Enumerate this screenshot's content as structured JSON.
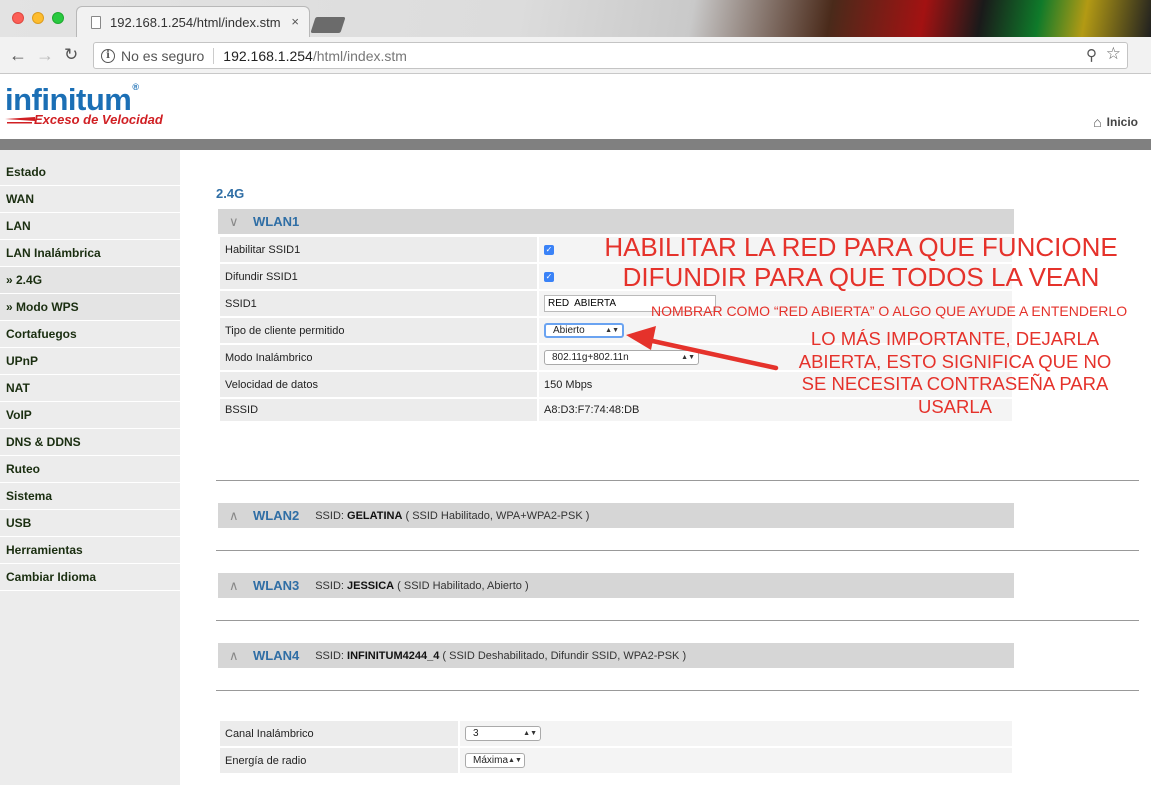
{
  "browser": {
    "tab_title": "192.168.1.254/html/index.stm",
    "tab_close": "×",
    "security_label": "No es seguro",
    "url_host": "192.168.1.254",
    "url_path": "/html/index.stm"
  },
  "header": {
    "logo_text": "infinitum",
    "logo_tm": "®",
    "logo_tagline": "Exceso de Velocidad",
    "home_label": "Inicio"
  },
  "sidebar": {
    "items": [
      {
        "label": "Estado"
      },
      {
        "label": "WAN"
      },
      {
        "label": "LAN"
      },
      {
        "label": "LAN Inalámbrica"
      },
      {
        "label": "» 2.4G"
      },
      {
        "label": "» Modo WPS"
      },
      {
        "label": "Cortafuegos"
      },
      {
        "label": "UPnP"
      },
      {
        "label": "NAT"
      },
      {
        "label": "VoIP"
      },
      {
        "label": "DNS & DDNS"
      },
      {
        "label": "Ruteo"
      },
      {
        "label": "Sistema"
      },
      {
        "label": "USB"
      },
      {
        "label": "Herramientas"
      },
      {
        "label": "Cambiar Idioma"
      }
    ]
  },
  "main": {
    "section_title": "2.4G",
    "wlan1": {
      "name": "WLAN1",
      "rows": {
        "enable_label": "Habilitar SSID1",
        "broadcast_label": "Difundir SSID1",
        "ssid_label": "SSID1",
        "ssid_value": "RED  ABIERTA",
        "client_type_label": "Tipo de cliente permitido",
        "client_type_value": "Abierto",
        "mode_label": "Modo Inalámbrico",
        "mode_value": "802.11g+802.11n",
        "rate_label": "Velocidad de datos",
        "rate_value": "150 Mbps",
        "bssid_label": "BSSID",
        "bssid_value": "A8:D3:F7:74:48:DB"
      }
    },
    "wlan2": {
      "name": "WLAN2",
      "ssid_prefix": "SSID:",
      "ssid": "GELATINA",
      "details": "( SSID Habilitado, WPA+WPA2-PSK )"
    },
    "wlan3": {
      "name": "WLAN3",
      "ssid_prefix": "SSID:",
      "ssid": "JESSICA",
      "details": "( SSID Habilitado, Abierto )"
    },
    "wlan4": {
      "name": "WLAN4",
      "ssid_prefix": "SSID:",
      "ssid": "INFINITUM4244_4",
      "details": "( SSID Deshabilitado, Difundir SSID, WPA2-PSK )"
    },
    "radio": {
      "channel_label": "Canal Inalámbrico",
      "channel_value": "3",
      "power_label": "Energía de radio",
      "power_value": "Máxima"
    }
  },
  "annotations": {
    "line1": "HABILITAR LA RED PARA QUE FUNCIONE",
    "line2": "DIFUNDIR PARA QUE TODOS LA VEAN",
    "ssid_note": "NOMBRAR COMO “RED ABIERTA” O ALGO QUE AYUDE A ENTENDERLO",
    "important_1": "LO MÁS IMPORTANTE, DEJARLA",
    "important_2": "ABIERTA, ESTO SIGNIFICA QUE NO",
    "important_3": "SE NECESITA CONTRASEÑA PARA",
    "important_4": "USARLA"
  },
  "colors": {
    "accent_blue": "#2f6ea5",
    "annotation_red": "#e5322b",
    "sidebar_bg": "#ececec"
  }
}
